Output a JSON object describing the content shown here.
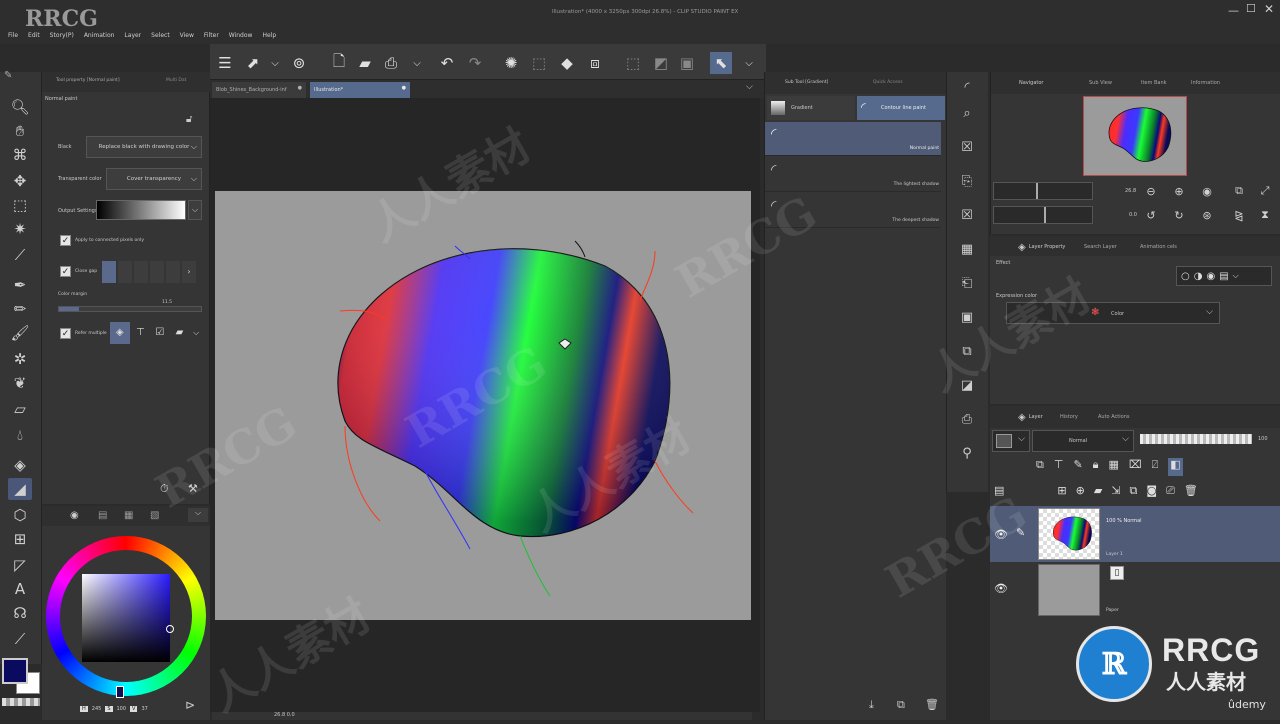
{
  "window": {
    "title": "Illustration* (4000 x 3250px 300dpi 26.8%) - CLIP STUDIO PAINT EX"
  },
  "brand": {
    "watermark": "RRCG",
    "watermark_cn": "人人素材",
    "bottom_brand": "RRCG",
    "bottom_brand_cn": "人人素材",
    "udemy": "ûdemy"
  },
  "menu": [
    "File",
    "Edit",
    "Story(P)",
    "Animation",
    "Layer",
    "Select",
    "View",
    "Filter",
    "Window",
    "Help"
  ],
  "tool_property": {
    "tab1": "Tool property [Normal paint]",
    "tab2": "Multi Dat",
    "header": "Normal paint",
    "black_label": "Black",
    "black_value": "Replace black with drawing color",
    "transparent_label": "Transparent color",
    "transparent_value": "Cover transparency",
    "output_label": "Output Settings",
    "apply_connected": "Apply to connected pixels only",
    "close_gap": "Close gap",
    "color_margin_label": "Color margin",
    "color_margin_value": "11.5",
    "refer_multiple": "Refer multiple"
  },
  "color_panel": {
    "h_label": "H",
    "h_value": "245",
    "s_label": "S",
    "s_value": "100",
    "v_label": "V",
    "v_value": "37"
  },
  "doc_tabs": [
    "Blob_Shines_Background-inf",
    "Illustration*"
  ],
  "zoom_readout": "26.8 0.0",
  "subtool": {
    "tab1": "Sub Tool [Gradient]",
    "tab2": "Quick Access",
    "group_gradient": "Gradient",
    "group_contour": "Contour line paint",
    "items": [
      "Normal paint",
      "The lightest shadow",
      "The deepest shadow"
    ]
  },
  "navigator": {
    "tabs": [
      "Navigator",
      "Sub View",
      "Item Bank",
      "Information"
    ],
    "zoom_value": "26.8",
    "rotate_value": "0.0"
  },
  "layer_property": {
    "tabs": [
      "Layer Property",
      "Search Layer",
      "Animation cels"
    ],
    "effect_label": "Effect",
    "expression_label": "Expression color",
    "expression_value": "Color"
  },
  "layer_panel": {
    "tabs": [
      "Layer",
      "History",
      "Auto Actions"
    ],
    "blend_mode": "Normal",
    "opacity": "100",
    "layers": [
      {
        "info": "100 % Normal",
        "name": "Layer 1"
      },
      {
        "info": "",
        "name": "Paper"
      }
    ]
  }
}
